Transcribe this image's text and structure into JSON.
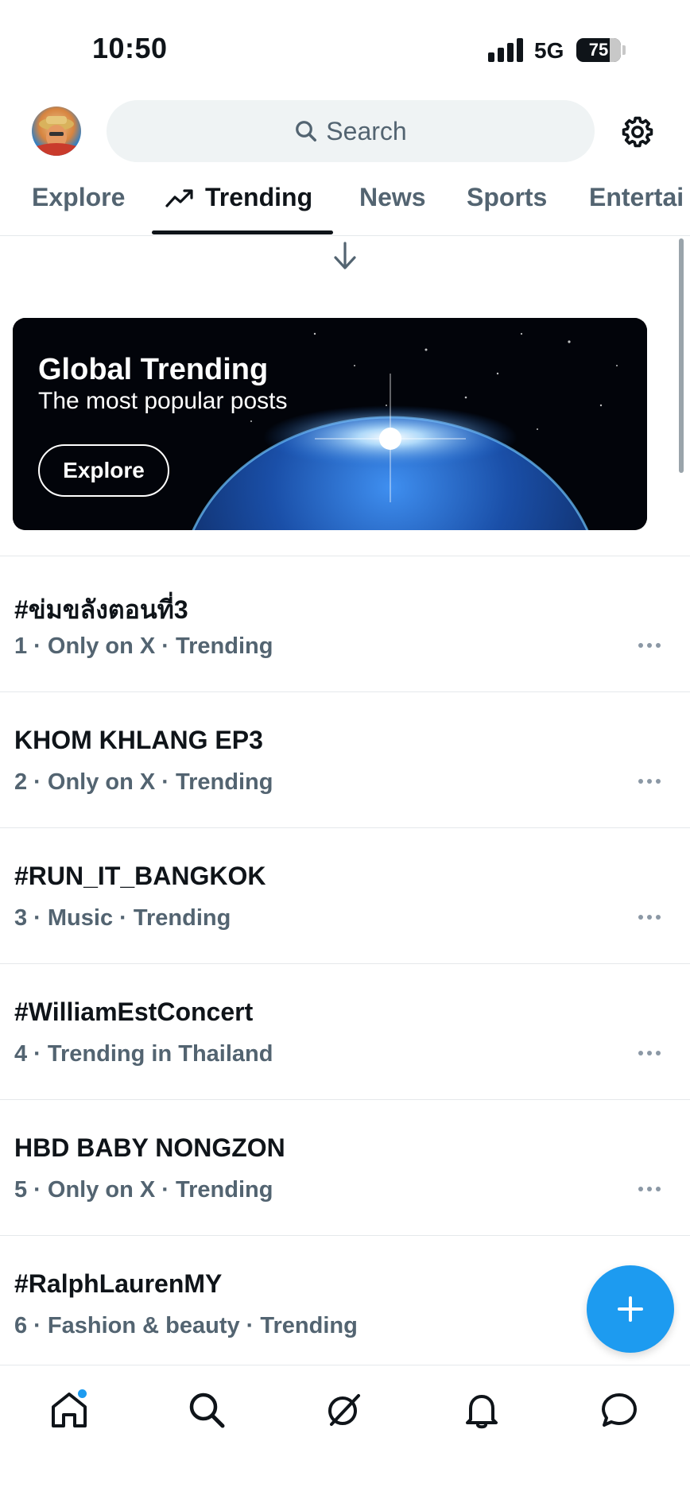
{
  "status_bar": {
    "time": "10:50",
    "network": "5G",
    "battery": "75",
    "battery_level": 0.75
  },
  "header": {
    "avatar_icon": "user-avatar",
    "search_placeholder": "Search",
    "settings_icon": "gear-icon"
  },
  "tabs": [
    {
      "label": "Explore",
      "active": false
    },
    {
      "label": "Trending",
      "active": true,
      "icon": "trending-arrow-icon"
    },
    {
      "label": "News",
      "active": false
    },
    {
      "label": "Sports",
      "active": false
    },
    {
      "label": "Entertai",
      "active": false
    }
  ],
  "banner": {
    "title": "Global Trending",
    "subtitle": "The most popular posts",
    "button_label": "Explore"
  },
  "trends": [
    {
      "title": "#ข่มขลังตอนที่3",
      "meta": "1 · Only on X · Trending"
    },
    {
      "title": "KHOM KHLANG EP3",
      "meta": "2 · Only on X · Trending"
    },
    {
      "title": "#RUN_IT_BANGKOK",
      "meta": "3 · Music · Trending"
    },
    {
      "title": "#WilliamEstConcert",
      "meta": "4 · Trending in Thailand"
    },
    {
      "title": "HBD BABY NONGZON",
      "meta": "5 · Only on X · Trending"
    },
    {
      "title": "#RalphLaurenMY",
      "meta": "6 · Fashion & beauty · Trending"
    }
  ],
  "fab_icon": "plus-icon",
  "bottom_nav": [
    "home-icon",
    "search-icon",
    "grok-icon",
    "bell-icon",
    "messages-icon"
  ],
  "colors": {
    "accent": "#1d9bf0",
    "text": "#0f1419",
    "secondary": "#536471",
    "divider": "#e5e8eb"
  }
}
